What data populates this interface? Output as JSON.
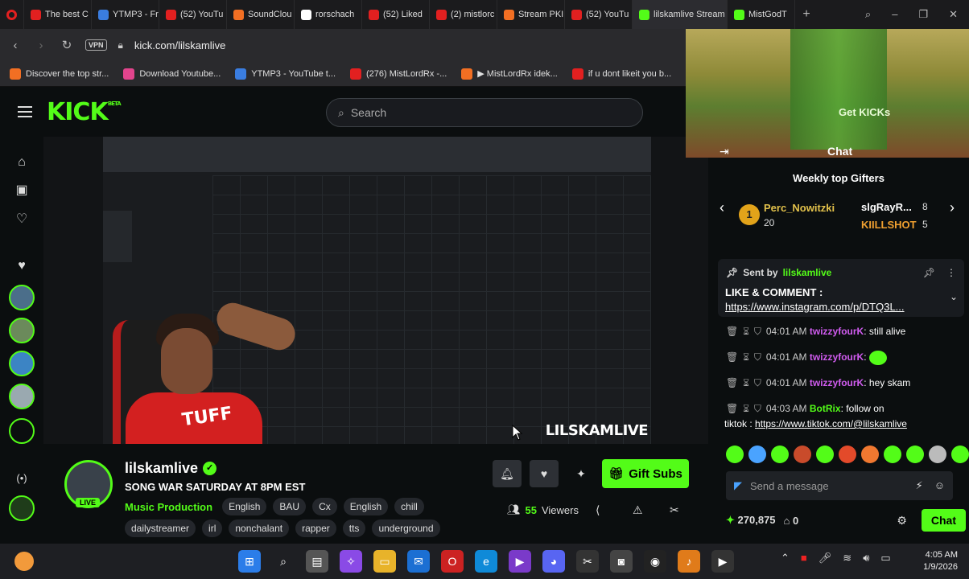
{
  "browser": {
    "tabs": [
      {
        "label": "The best C",
        "color": "#e22020"
      },
      {
        "label": "YTMP3 - Fr",
        "color": "#3a7de0"
      },
      {
        "label": "(52) YouTu",
        "color": "#e22020"
      },
      {
        "label": "SoundClou",
        "color": "#f26f23"
      },
      {
        "label": "rorschach",
        "color": "#ffffff"
      },
      {
        "label": "(52) Liked",
        "color": "#e22020"
      },
      {
        "label": "(2) mistlorc",
        "color": "#e22020"
      },
      {
        "label": "Stream PKI",
        "color": "#f26f23"
      },
      {
        "label": "(52) YouTu",
        "color": "#e22020"
      },
      {
        "label": "lilskamlive Stream",
        "color": "#53fc18"
      },
      {
        "label": "MistGodT",
        "color": "#53fc18"
      }
    ],
    "active_tab": 9,
    "vpn_label": "VPN",
    "url": "kick.com/lilskamlive",
    "bookmarks": [
      {
        "label": "Discover the top str...",
        "color": "#f26f23"
      },
      {
        "label": "Download Youtube...",
        "color": "#e2448d"
      },
      {
        "label": "YTMP3 - YouTube t...",
        "color": "#3a7de0"
      },
      {
        "label": "(276) MistLordRx -...",
        "color": "#e22020"
      },
      {
        "label": "▶ MistLordRx idek...",
        "color": "#f26f23"
      },
      {
        "label": "if u dont likeit you b...",
        "color": "#e22020"
      }
    ]
  },
  "kick": {
    "logo": "KICK",
    "logo_beta": "BETA",
    "search_placeholder": "Search"
  },
  "video": {
    "watermark": "LILSKAMLIVE",
    "shirt_text": "TUFF"
  },
  "channel": {
    "name": "lilskamlive",
    "live_label": "LIVE",
    "title": "SONG WAR SATURDAY AT 8PM EST",
    "category": "Music Production",
    "tags_row1": [
      "English",
      "BAU",
      "Cx",
      "English",
      "chill"
    ],
    "tags_row2": [
      "dailystreamer",
      "irl",
      "nonchalant",
      "rapper",
      "tts",
      "underground"
    ],
    "gift_subs_label": "Gift Subs",
    "viewers_count": "55",
    "viewers_label": "Viewers"
  },
  "chat": {
    "get_kicks": "Get KICKs",
    "header": "Chat",
    "weekly_title": "Weekly top Gifters",
    "gifters": [
      {
        "rank": "1",
        "name": "Perc_Nowitzki",
        "count": "20"
      },
      {
        "name": "slgRayR...",
        "count": "8"
      },
      {
        "name": "KIILLSHOT",
        "count": "5"
      }
    ],
    "pinned": {
      "sent_by_label": "Sent by",
      "sent_by_user": "lilskamlive",
      "text": "LIKE & COMMENT :",
      "link": "https://www.instagram.com/p/DTQ3L..."
    },
    "messages": [
      {
        "time": "04:01 AM",
        "user": "twizzyfourK",
        "text": ": still alive"
      },
      {
        "time": "04:01 AM",
        "user": "twizzyfourK",
        "text": ":"
      },
      {
        "time": "04:01 AM",
        "user": "twizzyfourK",
        "text": ": hey skam"
      },
      {
        "time": "04:03 AM",
        "user": "BotRix",
        "text": ": follow on",
        "text2": "tiktok : ",
        "link": "https://www.tiktok.com/@lilskamlive"
      }
    ],
    "emote_colors": [
      "#53fc18",
      "#4aa3ff",
      "#53fc18",
      "#c94b2b",
      "#53fc18",
      "#e34a2a",
      "#f07830",
      "#53fc18",
      "#53fc18",
      "#bbbbbb",
      "#53fc18"
    ],
    "send_placeholder": "Send a message",
    "kicks_balance": "270,875",
    "store_count": "0",
    "chat_button": "Chat"
  },
  "taskbar": {
    "time": "4:05 AM",
    "date": "1/9/2026"
  },
  "colors": {
    "accent": "#53fc18",
    "background": "#0b0e0f"
  }
}
